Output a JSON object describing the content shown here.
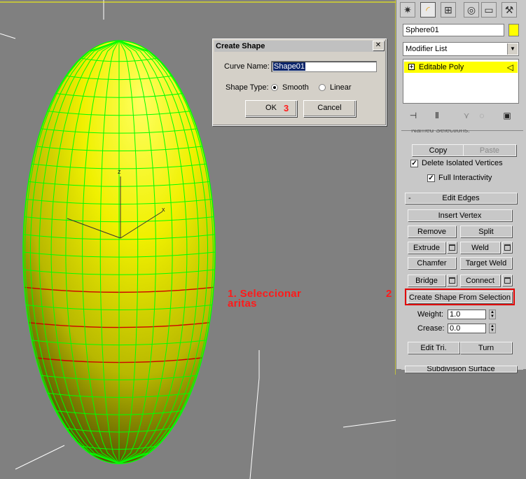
{
  "dialog": {
    "title": "Create Shape",
    "curve_name_label": "Curve Name:",
    "curve_name_value": "Shape01",
    "shape_type_label": "Shape Type:",
    "option_smooth": "Smooth",
    "option_linear": "Linear",
    "selected_shape_type": "Smooth",
    "ok_label": "OK",
    "cancel_label": "Cancel",
    "close_glyph": "✕"
  },
  "annotations": {
    "step1_line1": "1. Seleccionar",
    "step1_line2": "aritas",
    "step2": "2",
    "step3": "3",
    "color": "#ff1a1a"
  },
  "viewport": {
    "axis_z": "z",
    "axis_x": "x",
    "mesh_color": "#00ff00",
    "object_color": "#ffff00",
    "selected_edge_color": "#cc0000"
  },
  "panel": {
    "tab_icons": [
      "create-icon",
      "modify-icon",
      "hierarchy-icon",
      "motion-icon",
      "display-icon",
      "utilities-icon"
    ],
    "object_name": "Sphere01",
    "object_color": "#ffff00",
    "modifier_list_label": "Modifier List",
    "stack_item": "Editable Poly",
    "toolbar_icons": [
      "pin-stack-icon",
      "show-end-result-icon",
      "make-unique-icon",
      "remove-modifier-icon",
      "configure-sets-icon"
    ],
    "named_selection": {
      "title": "Named Selections:",
      "copy": "Copy",
      "paste": "Paste"
    },
    "delete_isolated_label": "Delete Isolated Vertices",
    "delete_isolated_checked": true,
    "full_interactivity_label": "Full Interactivity",
    "full_interactivity_checked": true,
    "edit_edges": {
      "collapse_sign": "-",
      "title": "Edit Edges",
      "insert_vertex": "Insert Vertex",
      "remove": "Remove",
      "split": "Split",
      "extrude": "Extrude",
      "weld": "Weld",
      "chamfer": "Chamfer",
      "target_weld": "Target Weld",
      "bridge": "Bridge",
      "connect": "Connect",
      "create_shape": "Create Shape From Selection",
      "weight_label": "Weight:",
      "weight_value": "1.0",
      "crease_label": "Crease:",
      "crease_value": "0.0",
      "edit_tri": "Edit Tri.",
      "turn": "Turn"
    },
    "next_rollout": "Subdivision Surface"
  }
}
